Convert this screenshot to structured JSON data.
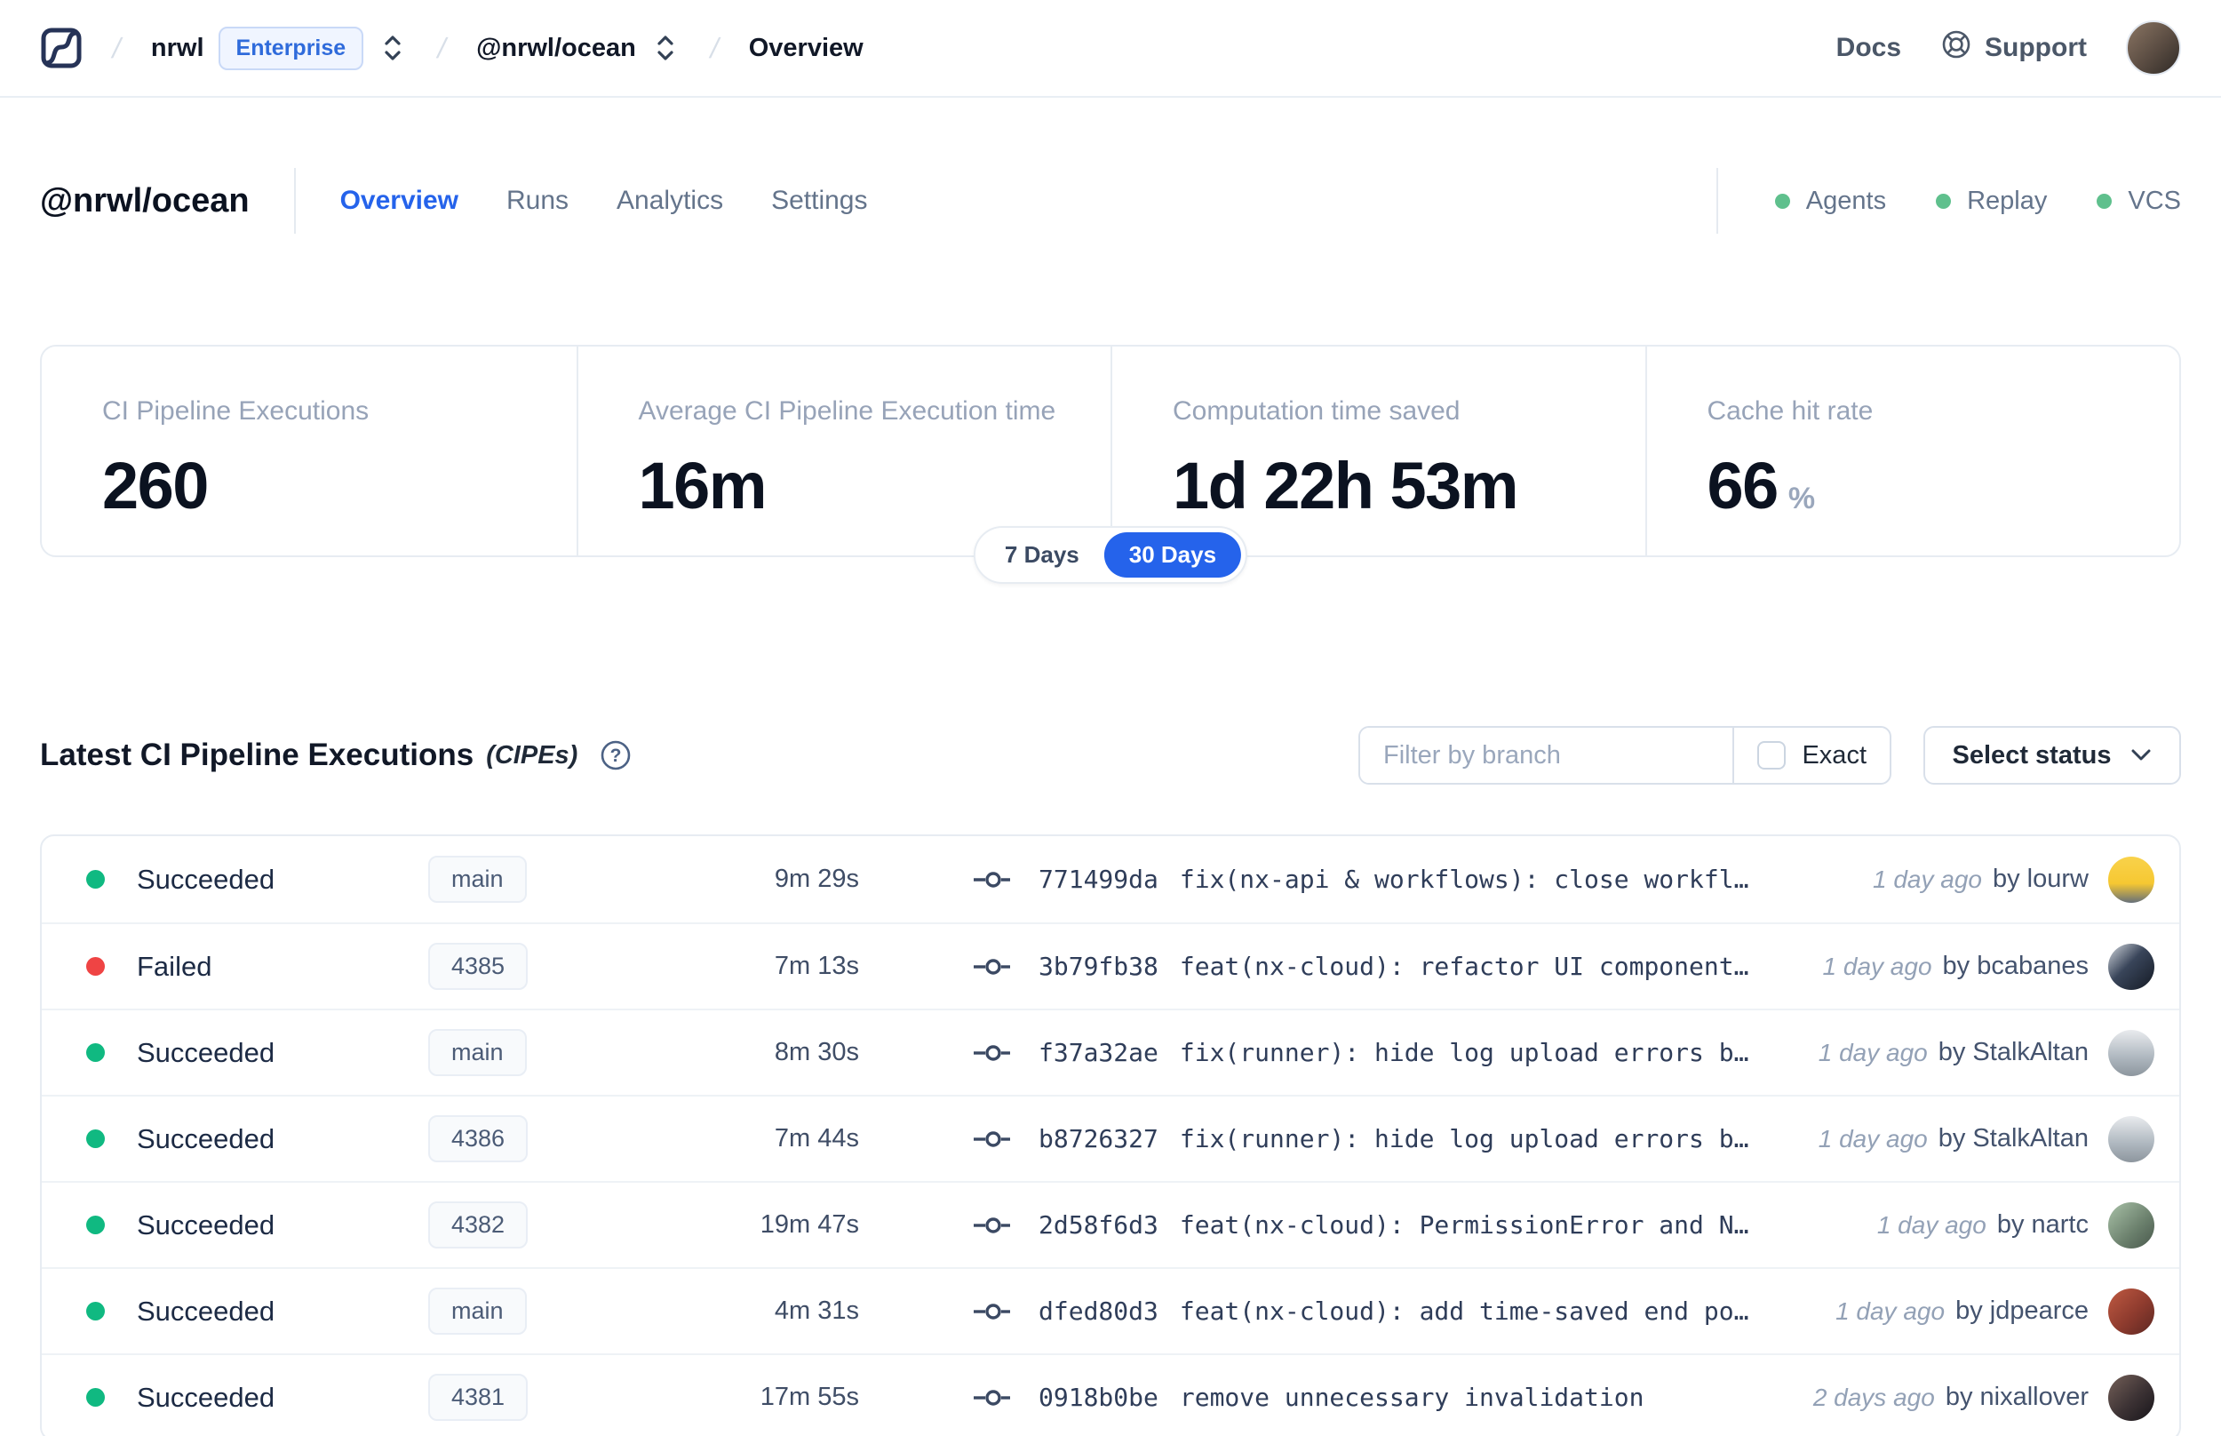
{
  "nav": {
    "breadcrumb": {
      "org": "nrwl",
      "org_badge": "Enterprise",
      "workspace": "@nrwl/ocean",
      "page": "Overview"
    },
    "docs_label": "Docs",
    "support_label": "Support"
  },
  "header": {
    "title": "@nrwl/ocean",
    "tabs": [
      {
        "label": "Overview",
        "state": "active"
      },
      {
        "label": "Runs"
      },
      {
        "label": "Analytics"
      },
      {
        "label": "Settings"
      }
    ],
    "services": [
      {
        "label": "Agents",
        "status": "online"
      },
      {
        "label": "Replay",
        "status": "online"
      },
      {
        "label": "VCS",
        "status": "online"
      }
    ]
  },
  "stats": {
    "cards": [
      {
        "label": "CI Pipeline Executions",
        "value": "260",
        "suffix": ""
      },
      {
        "label": "Average CI Pipeline Execution time",
        "value": "16m",
        "suffix": ""
      },
      {
        "label": "Computation time saved",
        "value": "1d 22h 53m",
        "suffix": ""
      },
      {
        "label": "Cache hit rate",
        "value": "66",
        "suffix": "%"
      }
    ],
    "range_toggle": [
      {
        "label": "7 Days"
      },
      {
        "label": "30 Days",
        "state": "active"
      }
    ]
  },
  "cipes": {
    "title": "Latest CI Pipeline Executions",
    "title_suffix": "(CIPEs)",
    "filter_placeholder": "Filter by branch",
    "filter_value": "",
    "exact_label": "Exact",
    "status_dropdown_label": "Select status",
    "rows": [
      {
        "status_label": "Succeeded",
        "status_class": "succeeded",
        "branch": "main",
        "duration": "9m 29s",
        "hash": "771499da",
        "message": "fix(nx-api & workflows): close workfl…",
        "time_ago": "1 day ago",
        "author": "by lourw",
        "avatar_class": "av-yellow"
      },
      {
        "status_label": "Failed",
        "status_class": "failed",
        "branch": "4385",
        "duration": "7m 13s",
        "hash": "3b79fb38",
        "message": "feat(nx-cloud): refactor UI component…",
        "time_ago": "1 day ago",
        "author": "by bcabanes",
        "avatar_class": "av-navy"
      },
      {
        "status_label": "Succeeded",
        "status_class": "succeeded",
        "branch": "main",
        "duration": "8m 30s",
        "hash": "f37a32ae",
        "message": "fix(runner): hide log upload errors b…",
        "time_ago": "1 day ago",
        "author": "by StalkAltan",
        "avatar_class": "av-gray"
      },
      {
        "status_label": "Succeeded",
        "status_class": "succeeded",
        "branch": "4386",
        "duration": "7m 44s",
        "hash": "b8726327",
        "message": "fix(runner): hide log upload errors b…",
        "time_ago": "1 day ago",
        "author": "by StalkAltan",
        "avatar_class": "av-gray"
      },
      {
        "status_label": "Succeeded",
        "status_class": "succeeded",
        "branch": "4382",
        "duration": "19m 47s",
        "hash": "2d58f6d3",
        "message": "feat(nx-cloud): PermissionError and N…",
        "time_ago": "1 day ago",
        "author": "by nartc",
        "avatar_class": "av-green"
      },
      {
        "status_label": "Succeeded",
        "status_class": "succeeded",
        "branch": "main",
        "duration": "4m 31s",
        "hash": "dfed80d3",
        "message": "feat(nx-cloud): add time-saved end po…",
        "time_ago": "1 day ago",
        "author": "by jdpearce",
        "avatar_class": "av-red"
      },
      {
        "status_label": "Succeeded",
        "status_class": "succeeded",
        "branch": "4381",
        "duration": "17m 55s",
        "hash": "0918b0be",
        "message": "remove unnecessary invalidation",
        "time_ago": "2 days ago",
        "author": "by nixallover",
        "avatar_class": "av-dark"
      }
    ]
  },
  "colors": {
    "accent_blue": "#2563eb",
    "success_green": "#10b981",
    "failed_red": "#ef4444",
    "service_dot_green": "#5fc08d",
    "enterprise_badge_blue": "#2f6bdb",
    "border_gray": "#e7ecf2"
  }
}
